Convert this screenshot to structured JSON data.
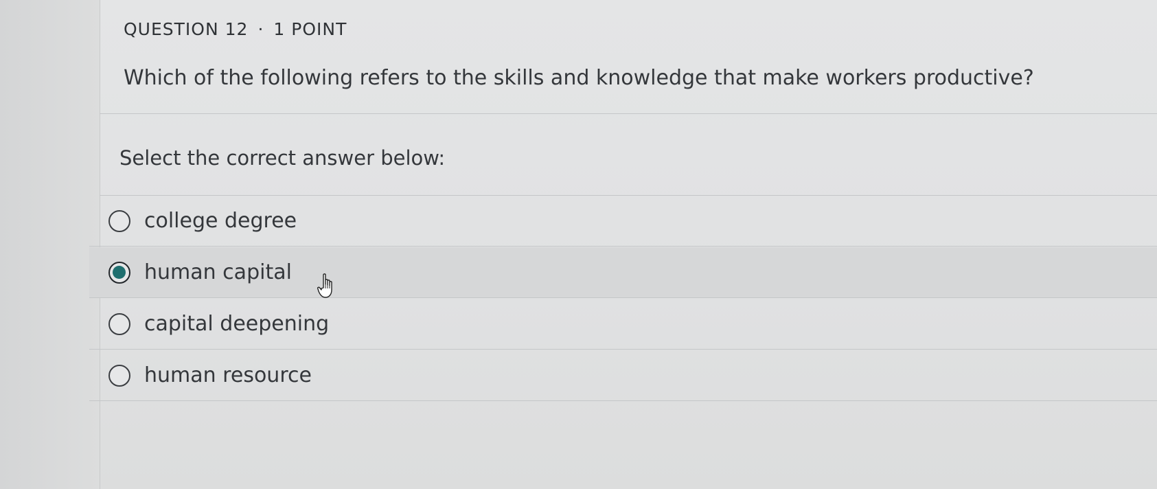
{
  "header": {
    "question_number": "QUESTION 12",
    "separator": "·",
    "points": "1 POINT"
  },
  "question_text": "Which of the following refers to the skills and knowledge that make workers productive?",
  "instructions": "Select the correct answer below:",
  "options": [
    {
      "label": "college degree",
      "selected": false
    },
    {
      "label": "human capital",
      "selected": true
    },
    {
      "label": "capital deepening",
      "selected": false
    },
    {
      "label": "human resource",
      "selected": false
    }
  ],
  "colors": {
    "selected_radio_fill": "#1f6f6f",
    "text": "#34373b"
  },
  "icons": {
    "pointer": "hand-pointer-icon"
  }
}
